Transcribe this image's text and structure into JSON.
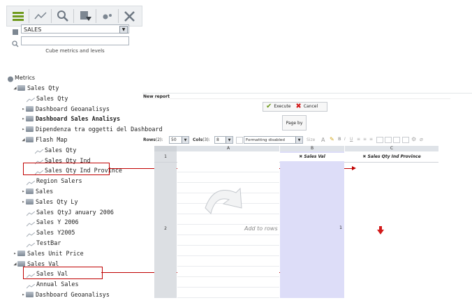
{
  "toolbar": {
    "icons": [
      "stack-icon",
      "line-chart-icon",
      "magnifier-icon",
      "filter-icon",
      "dots-icon",
      "tools-icon"
    ]
  },
  "cube": {
    "selected": "SALES",
    "search_placeholder": "",
    "caption": "Cube metrics and levels"
  },
  "tree": {
    "root": "Metrics",
    "items": [
      {
        "label": "Sales Qty",
        "type": "folder",
        "expanded": true,
        "bold": false
      },
      {
        "label": "Sales Qty",
        "type": "metric"
      },
      {
        "label": "Dashboard Geoanalisys",
        "type": "folder",
        "expanded": false
      },
      {
        "label": "Dashboard Sales Analisys",
        "type": "folder",
        "expanded": false,
        "bold": true
      },
      {
        "label": "Dipendenza tra oggetti del Dashboard",
        "type": "folder",
        "expanded": false
      },
      {
        "label": "Flash Map",
        "type": "folder",
        "expanded": true
      },
      {
        "label": "Sales Qty",
        "type": "metric"
      },
      {
        "label": "Sales Qty Ind",
        "type": "metric"
      },
      {
        "label": "Sales Qty Ind Province",
        "type": "metric",
        "highlight": true
      },
      {
        "label": "Region Salers",
        "type": "metric"
      },
      {
        "label": "Sales",
        "type": "folder",
        "expanded": false
      },
      {
        "label": "Sales Qty Ly",
        "type": "folder",
        "expanded": false
      },
      {
        "label": "Sales QtyJ anuary 2006",
        "type": "metric"
      },
      {
        "label": "Sales Y 2006",
        "type": "metric"
      },
      {
        "label": "Sales Y2005",
        "type": "metric"
      },
      {
        "label": "TestBar",
        "type": "metric"
      },
      {
        "label": "Sales Unit Price",
        "type": "folder",
        "expanded": false
      },
      {
        "label": "Sales Val",
        "type": "folder",
        "expanded": true
      },
      {
        "label": "Sales Val",
        "type": "metric",
        "highlight": true
      },
      {
        "label": "Annual Sales",
        "type": "metric"
      },
      {
        "label": "Dashboard Geoanalisys",
        "type": "folder",
        "expanded": false
      }
    ]
  },
  "report": {
    "title": "New report",
    "execute_label": "Execute",
    "cancel_label": "Cancel",
    "page_by_label": "Page by",
    "rows_label": "Rows",
    "rows_count": "(2)",
    "rows_value": "50",
    "cols_label": "Cols",
    "cols_count": "(3)",
    "cols_value": "8",
    "formatting_value": "Formatting disabled",
    "size_label": "Size",
    "columns": [
      "A",
      "B",
      "C"
    ],
    "row_numbers": [
      "1",
      "2"
    ],
    "header_b": "Sales Val",
    "header_c": "Sales Qty Ind Province",
    "add_to_rows": "Add to rows",
    "cell_value": "1"
  }
}
